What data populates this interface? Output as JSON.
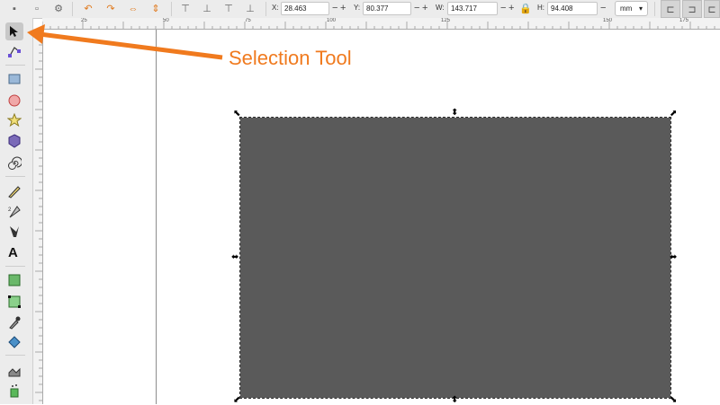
{
  "toolbar": {
    "x_label": "X:",
    "x_value": "28.463",
    "y_label": "Y:",
    "y_value": "80.377",
    "w_label": "W:",
    "w_value": "143.717",
    "h_label": "H:",
    "h_value": "94.408",
    "minus": "−",
    "plus": "+",
    "unit": "mm",
    "unit_caret": "▾"
  },
  "ruler": {
    "top_labels": [
      "25",
      "50",
      "75",
      "100",
      "125",
      "150",
      "175"
    ]
  },
  "annotation": {
    "label": "Selection Tool",
    "color": "#f07a1e"
  },
  "canvas": {
    "object_fill": "#5a5a5a"
  }
}
